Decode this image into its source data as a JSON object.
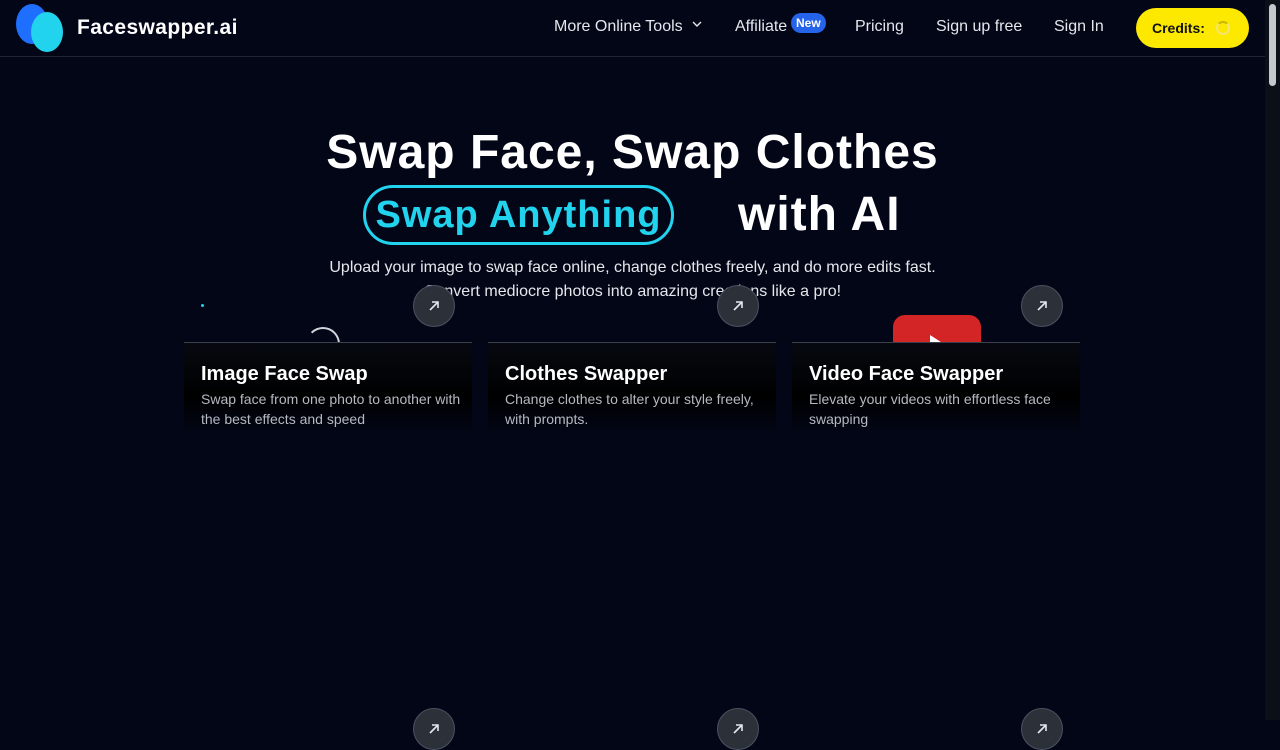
{
  "header": {
    "brand": "Faceswapper.ai",
    "nav": {
      "tools_label": "More Online Tools",
      "affiliate_label": "Affiliate",
      "affiliate_badge": "New",
      "pricing_label": "Pricing",
      "signup_label": "Sign up free",
      "signin_label": "Sign In"
    },
    "credits_label": "Credits:"
  },
  "hero": {
    "line1": "Swap Face, Swap Clothes",
    "highlight": "Swap Anything",
    "line2_suffix": "with AI",
    "subtitle_line1": "Upload your image to swap face online, change clothes freely, and do more edits fast.",
    "subtitle_line2": "Convert mediocre photos into amazing creations like a pro!"
  },
  "cards": [
    {
      "title": "Image Face Swap",
      "desc": "Swap face from one photo to another with the best effects and speed"
    },
    {
      "title": "Clothes Swapper",
      "desc": "Change clothes to alter your style freely, with prompts."
    },
    {
      "title": "Video Face Swapper",
      "desc": "Elevate your videos with effortless face swapping"
    }
  ],
  "icons": {
    "logo": "faceswapper-logo-icon",
    "chevron": "chevron-down-icon",
    "arrow": "arrow-up-right-icon",
    "spinner": "loading-spinner-icon",
    "play": "play-icon"
  },
  "colors": {
    "background": "#020617",
    "accent_cyan": "#22d3ee",
    "accent_blue": "#1f6fff",
    "credits_yellow": "#fde900",
    "badge_blue": "#2563eb",
    "video_red": "#d32525"
  }
}
